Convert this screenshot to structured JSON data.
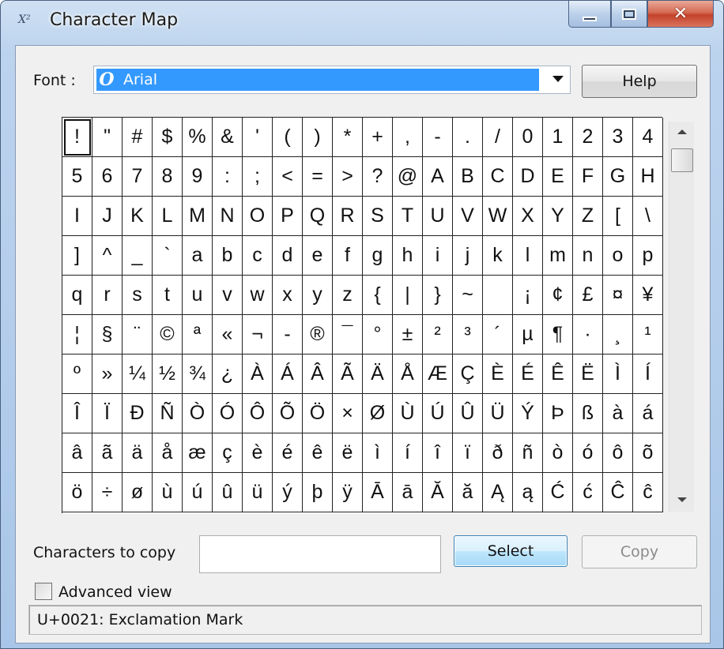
{
  "window": {
    "title": "Character Map",
    "icon_text": "X²",
    "controls": {
      "minimize": "minimize",
      "maximize": "maximize",
      "close": "✕"
    }
  },
  "font": {
    "label": "Font :",
    "selected": "Arial",
    "icon_glyph": "O"
  },
  "help_button": "Help",
  "character_grid": {
    "selected_index": 0,
    "rows": [
      [
        "!",
        "\"",
        "#",
        "$",
        "%",
        "&",
        "'",
        "(",
        ")",
        "*",
        "+",
        ",",
        "-",
        ".",
        "/",
        "0",
        "1",
        "2",
        "3",
        "4"
      ],
      [
        "5",
        "6",
        "7",
        "8",
        "9",
        ":",
        ";",
        "<",
        "=",
        ">",
        "?",
        "@",
        "A",
        "B",
        "C",
        "D",
        "E",
        "F",
        "G",
        "H"
      ],
      [
        "I",
        "J",
        "K",
        "L",
        "M",
        "N",
        "O",
        "P",
        "Q",
        "R",
        "S",
        "T",
        "U",
        "V",
        "W",
        "X",
        "Y",
        "Z",
        "[",
        "\\"
      ],
      [
        "]",
        "^",
        "_",
        "`",
        "a",
        "b",
        "c",
        "d",
        "e",
        "f",
        "g",
        "h",
        "i",
        "j",
        "k",
        "l",
        "m",
        "n",
        "o",
        "p"
      ],
      [
        "q",
        "r",
        "s",
        "t",
        "u",
        "v",
        "w",
        "x",
        "y",
        "z",
        "{",
        "|",
        "}",
        "~",
        " ",
        "¡",
        "¢",
        "£",
        "¤",
        "¥"
      ],
      [
        "¦",
        "§",
        "¨",
        "©",
        "ª",
        "«",
        "¬",
        "-",
        "®",
        "¯",
        "°",
        "±",
        "²",
        "³",
        "´",
        "µ",
        "¶",
        "·",
        "¸",
        "¹"
      ],
      [
        "º",
        "»",
        "¼",
        "½",
        "¾",
        "¿",
        "À",
        "Á",
        "Â",
        "Ã",
        "Ä",
        "Å",
        "Æ",
        "Ç",
        "È",
        "É",
        "Ê",
        "Ë",
        "Ì",
        "Í"
      ],
      [
        "Î",
        "Ï",
        "Ð",
        "Ñ",
        "Ò",
        "Ó",
        "Ô",
        "Õ",
        "Ö",
        "×",
        "Ø",
        "Ù",
        "Ú",
        "Û",
        "Ü",
        "Ý",
        "Þ",
        "ß",
        "à",
        "á"
      ],
      [
        "â",
        "ã",
        "ä",
        "å",
        "æ",
        "ç",
        "è",
        "é",
        "ê",
        "ë",
        "ì",
        "í",
        "î",
        "ï",
        "ð",
        "ñ",
        "ò",
        "ó",
        "ô",
        "õ"
      ],
      [
        "ö",
        "÷",
        "ø",
        "ù",
        "ú",
        "û",
        "ü",
        "ý",
        "þ",
        "ÿ",
        "Ā",
        "ā",
        "Ă",
        "ă",
        "Ą",
        "ą",
        "Ć",
        "ć",
        "Ĉ",
        "ĉ"
      ]
    ]
  },
  "copy": {
    "label": "Characters to copy",
    "value": "",
    "select_button": "Select",
    "copy_button": "Copy"
  },
  "advanced_view": {
    "label": "Advanced view",
    "checked": false
  },
  "status": {
    "text": "U+0021: Exclamation Mark"
  },
  "colors": {
    "selection_blue": "#3399ff",
    "select_button_accent": "#a7d9f5",
    "window_frame": "#bcd3ee"
  }
}
